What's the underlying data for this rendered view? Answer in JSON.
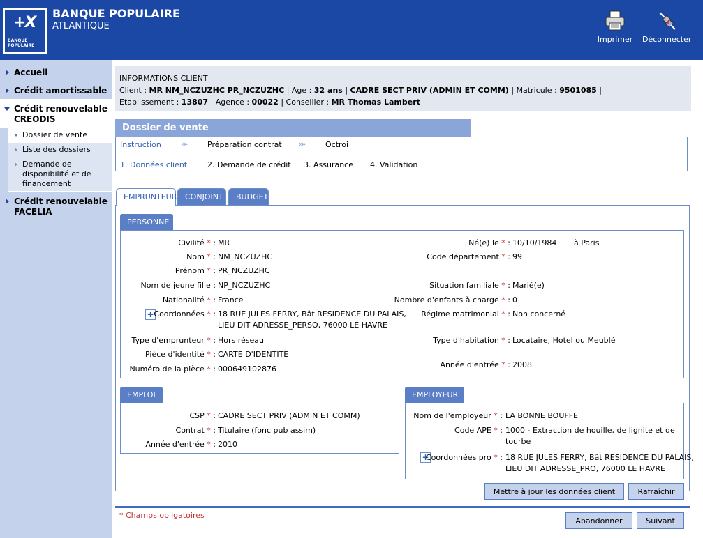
{
  "header": {
    "bank_name": "BANQUE POPULAIRE",
    "bank_sub": "ATLANTIQUE",
    "logo_text": "BANQUE POPULAIRE",
    "print_label": "Imprimer",
    "logout_label": "Déconnecter"
  },
  "sidebar": {
    "items": [
      {
        "label": "Accueil"
      },
      {
        "label": "Crédit amortissable"
      },
      {
        "label": "Crédit renouvelable CREODIS"
      },
      {
        "label": "Crédit renouvelable FACELIA"
      }
    ],
    "subitems": [
      {
        "label": "Dossier de vente"
      },
      {
        "label": "Liste des dossiers"
      },
      {
        "label": "Demande de disponibilité et de financement"
      }
    ]
  },
  "client": {
    "heading": "INFORMATIONS CLIENT",
    "client_label": "Client : ",
    "client_name": "MR NM_NCZUZHC PR_NCZUZHC",
    "age_label": " | Age : ",
    "age": "32 ans",
    "csp": "CADRE SECT PRIV (ADMIN ET COMM)",
    "matricule_label": " | Matricule : ",
    "matricule": "9501085",
    "etab_label": "Etablissement : ",
    "etablissement": "13807",
    "agence_label": " | Agence : ",
    "agence": "00022",
    "conseiller_label": " | Conseiller : ",
    "conseiller": "MR Thomas Lambert"
  },
  "dossier": {
    "title": "Dossier de vente",
    "steps": [
      "Instruction",
      "Préparation contrat",
      "Octroi"
    ],
    "substeps": [
      "1. Données client",
      "2. Demande de crédit",
      "3. Assurance",
      "4. Validation"
    ]
  },
  "tabs": [
    "EMPRUNTEUR",
    "CONJOINT",
    "BUDGET"
  ],
  "personne": {
    "title": "PERSONNE",
    "civilite_label": "Civilité",
    "civilite": "MR",
    "nom_label": "Nom",
    "nom": "NM_NCZUZHC",
    "prenom_label": "Prénom",
    "prenom": "PR_NCZUZHC",
    "nom_jf_label": "Nom de jeune fille",
    "nom_jf": "NP_NCZUZHC",
    "nationalite_label": "Nationalité",
    "nationalite": "France",
    "coord_label": "Coordonnées",
    "coord_line1": "18 RUE JULES FERRY, Bât RESIDENCE DU PALAIS,",
    "coord_line2": "LIEU DIT ADRESSE_PERSO, 76000 LE HAVRE",
    "type_emp_label": "Type d'emprunteur",
    "type_emp": "Hors réseau",
    "piece_label": "Pièce d'identité",
    "piece": "CARTE D'IDENTITE",
    "num_piece_label": "Numéro de la pièce",
    "num_piece": "000649102876",
    "ne_label": "Né(e) le",
    "ne_date": "10/10/1984",
    "ne_lieu": "à Paris",
    "code_dep_label": "Code département",
    "code_dep": "99",
    "sit_fam_label": "Situation familiale",
    "sit_fam": "Marié(e)",
    "enfants_label": "Nombre d'enfants à charge",
    "enfants": "0",
    "regime_label": "Régime matrimonial",
    "regime": "Non concerné",
    "habitation_label": "Type d'habitation",
    "habitation": "Locataire, Hotel ou Meublé",
    "annee_entree_label": "Année d'entrée",
    "annee_entree": "2008"
  },
  "emploi": {
    "title": "EMPLOI",
    "csp_label": "CSP",
    "csp": "CADRE SECT PRIV (ADMIN ET COMM)",
    "contrat_label": "Contrat",
    "contrat": "Titulaire (fonc pub assim)",
    "annee_label": "Année d'entrée",
    "annee": "2010"
  },
  "employeur": {
    "title": "EMPLOYEUR",
    "nom_label": "Nom de l'employeur",
    "nom": "LA BONNE BOUFFE",
    "ape_label": "Code APE",
    "ape_line1": "1000 - Extraction de houille, de lignite et de",
    "ape_line2": "tourbe",
    "coord_label": "Coordonnées pro",
    "coord_line1": "18 RUE JULES FERRY, Bât RESIDENCE DU PALAIS,",
    "coord_line2": "LIEU DIT ADRESSE_PRO, 76000 LE HAVRE"
  },
  "buttons": {
    "update": "Mettre à jour les données client",
    "refresh": "Rafraîchir",
    "abandon": "Abandonner",
    "next": "Suivant"
  },
  "req_marker": "*",
  "required_note": "* Champs obligatoires",
  "colors": {
    "header": "#1b47a5",
    "sidebar": "#c5d2ec",
    "accent": "#5b7fc6",
    "required": "#d03030"
  }
}
